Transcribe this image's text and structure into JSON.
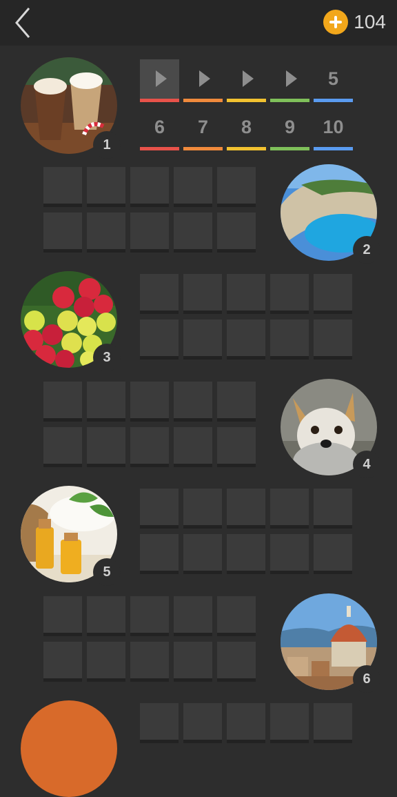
{
  "header": {
    "coins": "104"
  },
  "levels": [
    {
      "label": "",
      "state": "current",
      "color": "#e8524a"
    },
    {
      "label": "",
      "state": "unlocked",
      "color": "#f08a3c"
    },
    {
      "label": "",
      "state": "unlocked",
      "color": "#f2c230"
    },
    {
      "label": "",
      "state": "unlocked",
      "color": "#7fc05a"
    },
    {
      "label": "5",
      "state": "locked",
      "color": "#5a9bf0"
    },
    {
      "label": "6",
      "state": "locked",
      "color": "#e8524a"
    },
    {
      "label": "7",
      "state": "locked",
      "color": "#f08a3c"
    },
    {
      "label": "8",
      "state": "locked",
      "color": "#f2c230"
    },
    {
      "label": "9",
      "state": "locked",
      "color": "#7fc05a"
    },
    {
      "label": "10",
      "state": "locked",
      "color": "#5a9bf0"
    }
  ],
  "puzzles": [
    {
      "number": "1",
      "subject": "coffee"
    },
    {
      "number": "2",
      "subject": "beach"
    },
    {
      "number": "3",
      "subject": "grapes"
    },
    {
      "number": "4",
      "subject": "dog"
    },
    {
      "number": "5",
      "subject": "oils"
    },
    {
      "number": "6",
      "subject": "cathedral"
    }
  ]
}
